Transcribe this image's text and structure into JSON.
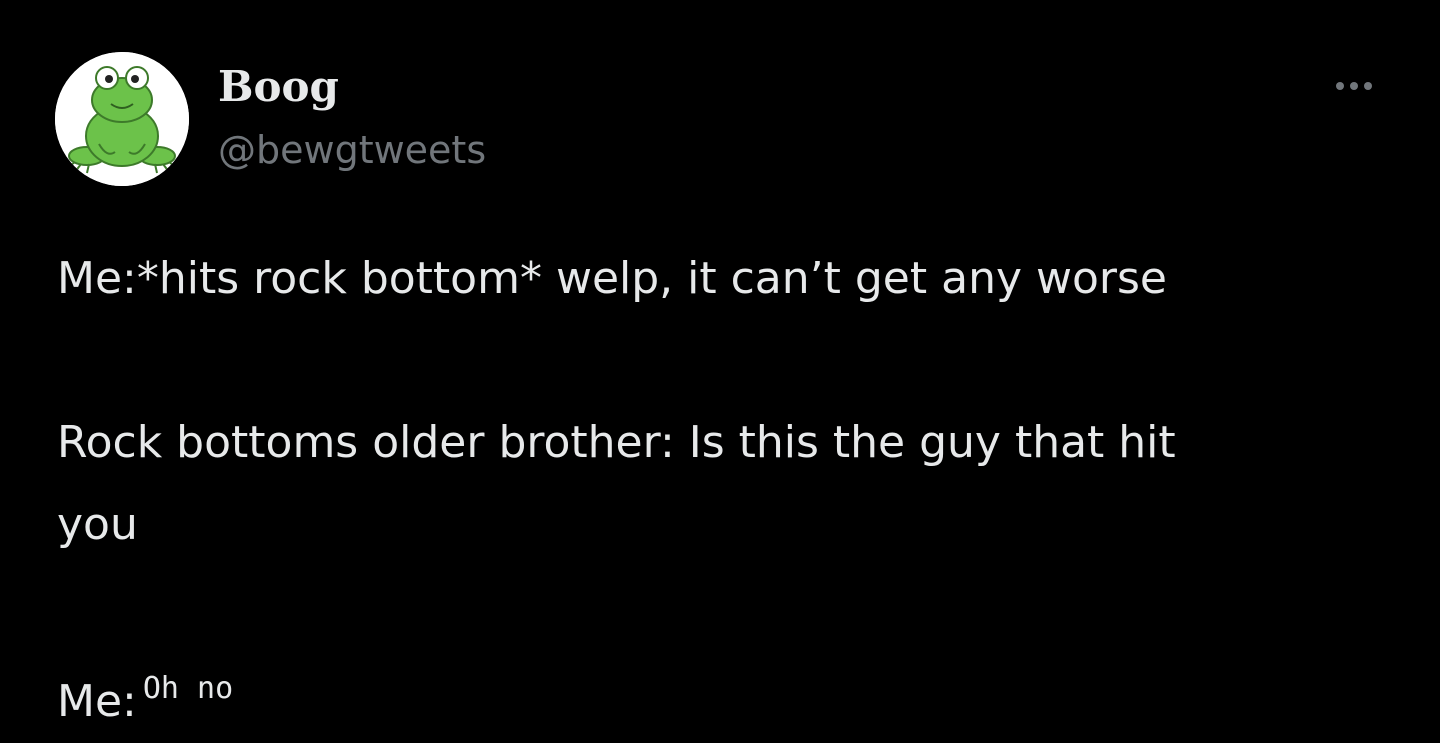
{
  "author": {
    "display_name": "Boog",
    "handle": "@bewgtweets",
    "avatar_icon": "frog-avatar-icon"
  },
  "menu": {
    "icon": "more-options-icon"
  },
  "tweet": {
    "line1": "Me:*hits rock bottom* welp, it can’t get any worse",
    "line2": "Rock bottoms older brother: Is this the guy that hit",
    "line3": "you",
    "line4_prefix": "Me:",
    "line4_small": "Oh no"
  },
  "colors": {
    "background": "#000000",
    "primary_text": "#e7e9ea",
    "secondary_text": "#71767b",
    "frog_green": "#6cc24a"
  }
}
